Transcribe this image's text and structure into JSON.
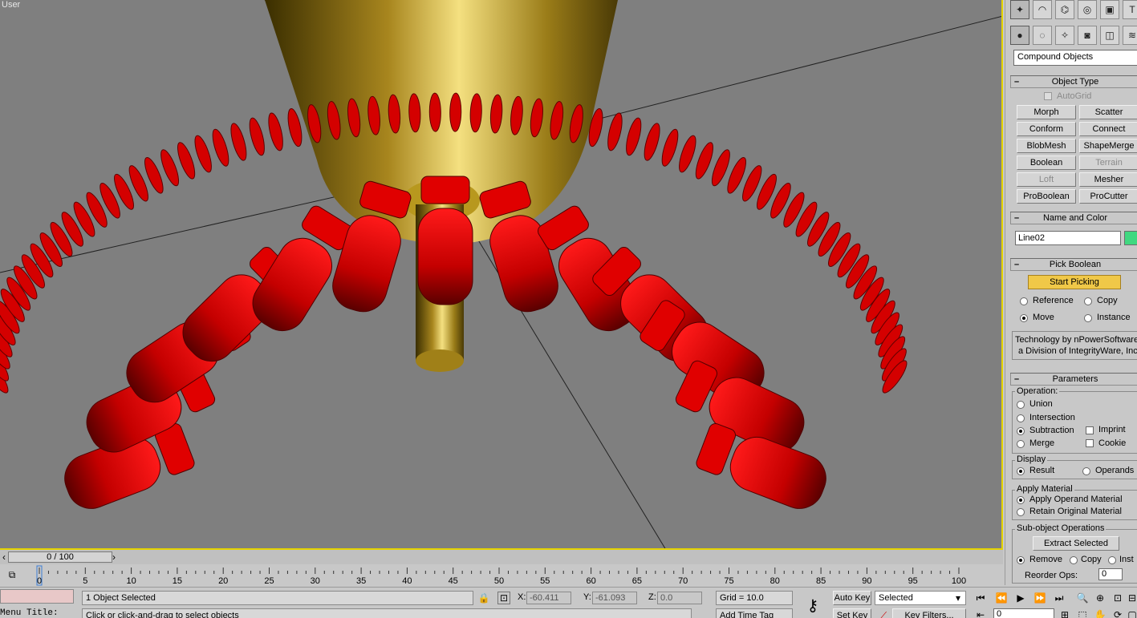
{
  "viewport": {
    "label": "User"
  },
  "panel": {
    "tabs": [
      "create-icon",
      "modify-icon",
      "hierarchy-icon",
      "motion-icon",
      "display-icon",
      "utilities-icon"
    ],
    "category": "Compound Objects",
    "object_type": {
      "title": "Object Type",
      "autogrid": "AutoGrid",
      "buttons": [
        "Morph",
        "Scatter",
        "Conform",
        "Connect",
        "BlobMesh",
        "ShapeMerge",
        "Boolean",
        "Terrain",
        "Loft",
        "Mesher",
        "ProBoolean",
        "ProCutter"
      ]
    },
    "name_color": {
      "title": "Name and Color",
      "name": "Line02",
      "color": "#40d880"
    },
    "pick_boolean": {
      "title": "Pick Boolean",
      "start_picking": "Start Picking",
      "reference": "Reference",
      "copy": "Copy",
      "move": "Move",
      "instance": "Instance",
      "tech_line1": "Technology by nPowerSoftware",
      "tech_line2": "a Division of IntegrityWare, Inc."
    },
    "parameters": {
      "title": "Parameters",
      "operation": "Operation:",
      "union": "Union",
      "intersection": "Intersection",
      "subtraction": "Subtraction",
      "merge": "Merge",
      "imprint": "Imprint",
      "cookie": "Cookie",
      "display": "Display",
      "result": "Result",
      "operands": "Operands",
      "apply_material": "Apply Material",
      "apply_operand": "Apply Operand Material",
      "retain_original": "Retain Original Material",
      "subobject": "Sub-object Operations",
      "extract_selected": "Extract Selected",
      "remove": "Remove",
      "copy": "Copy",
      "inst": "Inst",
      "reorder_ops": "Reorder Ops:",
      "reorder_value": "0"
    }
  },
  "timeline": {
    "slider": "0 / 100",
    "ticks": [
      "0",
      "5",
      "10",
      "15",
      "20",
      "25",
      "30",
      "35",
      "40",
      "45",
      "50",
      "55",
      "60",
      "65",
      "70",
      "75",
      "80",
      "85",
      "90",
      "95",
      "100"
    ]
  },
  "status": {
    "selection": "1 Object Selected",
    "prompt": "Click or click-and-drag to select objects",
    "x_label": "X:",
    "x_value": "-60.411",
    "y_label": "Y:",
    "y_value": "-61.093",
    "z_label": "Z:",
    "z_value": "0.0",
    "grid": "Grid = 10.0",
    "add_time_tag": "Add Time Tag",
    "auto_key": "Auto Key",
    "set_key": "Set Key",
    "selected": "Selected",
    "key_filters": "Key Filters...",
    "frame": "0",
    "menu_title": "Menu Title:"
  }
}
